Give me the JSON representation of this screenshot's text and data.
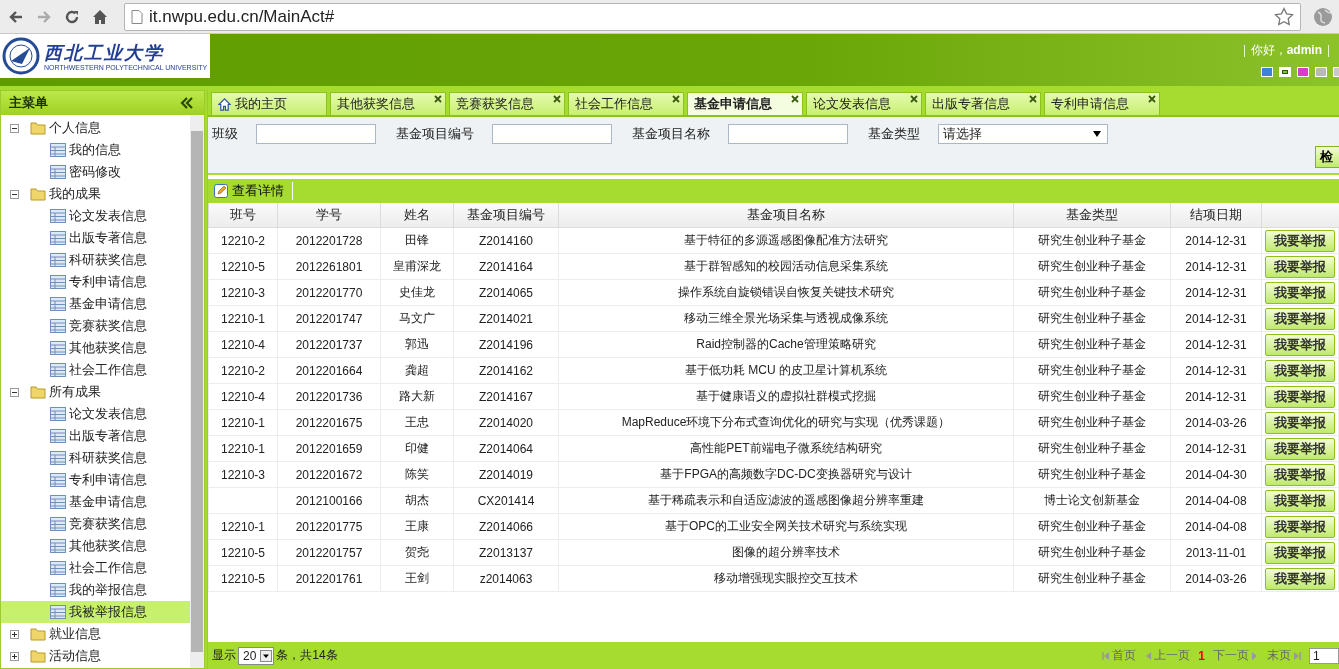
{
  "browser": {
    "url": "it.nwpu.edu.cn/MainAct#"
  },
  "header": {
    "logo_title": "西北工业大学",
    "logo_subtitle": "NORTHWESTERN POLYTECHNICAL UNIVERSITY",
    "greeting": "你好，**admin**",
    "themes": [
      {
        "color": "#3b82d8",
        "selected": false
      },
      {
        "color": "#7cc52a",
        "selected": true
      },
      {
        "color": "#d93cc8",
        "selected": false
      },
      {
        "color": "#b9b9b9",
        "selected": false
      },
      {
        "color": "#c9c9c9",
        "selected": false
      }
    ]
  },
  "sidebar": {
    "title": "主菜单",
    "tree": [
      {
        "label": "个人信息",
        "expanded": true,
        "children": [
          {
            "label": "我的信息",
            "selected": false
          },
          {
            "label": "密码修改",
            "selected": false
          }
        ]
      },
      {
        "label": "我的成果",
        "expanded": true,
        "children": [
          {
            "label": "论文发表信息",
            "selected": false
          },
          {
            "label": "出版专著信息",
            "selected": false
          },
          {
            "label": "科研获奖信息",
            "selected": false
          },
          {
            "label": "专利申请信息",
            "selected": false
          },
          {
            "label": "基金申请信息",
            "selected": false
          },
          {
            "label": "竞赛获奖信息",
            "selected": false
          },
          {
            "label": "其他获奖信息",
            "selected": false
          },
          {
            "label": "社会工作信息",
            "selected": false
          }
        ]
      },
      {
        "label": "所有成果",
        "expanded": true,
        "children": [
          {
            "label": "论文发表信息",
            "selected": false
          },
          {
            "label": "出版专著信息",
            "selected": false
          },
          {
            "label": "科研获奖信息",
            "selected": false
          },
          {
            "label": "专利申请信息",
            "selected": false
          },
          {
            "label": "基金申请信息",
            "selected": false
          },
          {
            "label": "竞赛获奖信息",
            "selected": false
          },
          {
            "label": "其他获奖信息",
            "selected": false
          },
          {
            "label": "社会工作信息",
            "selected": false
          },
          {
            "label": "我的举报信息",
            "selected": false
          },
          {
            "label": "我被举报信息",
            "selected": true
          }
        ]
      },
      {
        "label": "就业信息",
        "expanded": false
      },
      {
        "label": "活动信息",
        "expanded": false
      }
    ]
  },
  "tabs": [
    {
      "label": "我的主页",
      "kind": "home",
      "selected": false
    },
    {
      "label": "其他获奖信息",
      "kind": "closable",
      "selected": false
    },
    {
      "label": "竞赛获奖信息",
      "kind": "closable",
      "selected": false
    },
    {
      "label": "社会工作信息",
      "kind": "closable",
      "selected": false
    },
    {
      "label": "基金申请信息",
      "kind": "closable",
      "selected": true
    },
    {
      "label": "论文发表信息",
      "kind": "closable",
      "selected": false
    },
    {
      "label": "出版专著信息",
      "kind": "closable",
      "selected": false
    },
    {
      "label": "专利申请信息",
      "kind": "closable",
      "selected": false
    }
  ],
  "filters": [
    {
      "label": "班级",
      "kind": "input"
    },
    {
      "label": "基金项目编号",
      "kind": "input"
    },
    {
      "label": "基金项目名称",
      "kind": "input"
    },
    {
      "label": "基金类型",
      "kind": "select",
      "value": "请选择"
    }
  ],
  "search_button": "检",
  "toolbar": {
    "view_details": "查看详情"
  },
  "table": {
    "columns": [
      "班号",
      "学号",
      "姓名",
      "基金项目编号",
      "基金项目名称",
      "基金类型",
      "结项日期"
    ],
    "rows": [
      {
        "cells": [
          "12210-2",
          "2012201728",
          "田锋",
          "Z2014160",
          "基于特征的多源遥感图像配准方法研究",
          "研究生创业种子基金",
          "2014-12-31"
        ],
        "action": "我要举报"
      },
      {
        "cells": [
          "12210-5",
          "2012261801",
          "皇甫深龙",
          "Z2014164",
          "基于群智感知的校园活动信息采集系统",
          "研究生创业种子基金",
          "2014-12-31"
        ],
        "action": "我要举报"
      },
      {
        "cells": [
          "12210-3",
          "2012201770",
          "史佳龙",
          "Z2014065",
          "操作系统自旋锁错误自恢复关键技术研究",
          "研究生创业种子基金",
          "2014-12-31"
        ],
        "action": "我要举报"
      },
      {
        "cells": [
          "12210-1",
          "2012201747",
          "马文广",
          "Z2014021",
          "移动三维全景光场采集与透视成像系统",
          "研究生创业种子基金",
          "2014-12-31"
        ],
        "action": "我要举报"
      },
      {
        "cells": [
          "12210-4",
          "2012201737",
          "郭迅",
          "Z2014196",
          "Raid控制器的Cache管理策略研究",
          "研究生创业种子基金",
          "2014-12-31"
        ],
        "action": "我要举报"
      },
      {
        "cells": [
          "12210-2",
          "2012201664",
          "龚超",
          "Z2014162",
          "基于低功耗 MCU 的皮卫星计算机系统",
          "研究生创业种子基金",
          "2014-12-31"
        ],
        "action": "我要举报"
      },
      {
        "cells": [
          "12210-4",
          "2012201736",
          "路大新",
          "Z2014167",
          "基于健康语义的虚拟社群模式挖掘",
          "研究生创业种子基金",
          "2014-12-31"
        ],
        "action": "我要举报"
      },
      {
        "cells": [
          "12210-1",
          "2012201675",
          "王忠",
          "Z2014020",
          "MapReduce环境下分布式查询优化的研究与实现（优秀课题）",
          "研究生创业种子基金",
          "2014-03-26"
        ],
        "action": "我要举报"
      },
      {
        "cells": [
          "12210-1",
          "2012201659",
          "印健",
          "Z2014064",
          "高性能PET前端电子微系统结构研究",
          "研究生创业种子基金",
          "2014-12-31"
        ],
        "action": "我要举报"
      },
      {
        "cells": [
          "12210-3",
          "2012201672",
          "陈笑",
          "Z2014019",
          "基于FPGA的高频数字DC-DC变换器研究与设计",
          "研究生创业种子基金",
          "2014-04-30"
        ],
        "action": "我要举报"
      },
      {
        "cells": [
          "",
          "2012100166",
          "胡杰",
          "CX201414",
          "基于稀疏表示和自适应滤波的遥感图像超分辨率重建",
          "博士论文创新基金",
          "2014-04-08"
        ],
        "action": "我要举报"
      },
      {
        "cells": [
          "12210-1",
          "2012201775",
          "王康",
          "Z2014066",
          "基于OPC的工业安全网关技术研究与系统实现",
          "研究生创业种子基金",
          "2014-04-08"
        ],
        "action": "我要举报"
      },
      {
        "cells": [
          "12210-5",
          "2012201757",
          "贺尧",
          "Z2013137",
          "图像的超分辨率技术",
          "研究生创业种子基金",
          "2013-11-01"
        ],
        "action": "我要举报"
      },
      {
        "cells": [
          "12210-5",
          "2012201761",
          "王剑",
          "z2014063",
          "移动增强现实眼控交互技术",
          "研究生创业种子基金",
          "2014-03-26"
        ],
        "action": "我要举报"
      }
    ]
  },
  "pager": {
    "show_label": "显示",
    "page_size": "20",
    "count_text": "条，共14条",
    "nav": [
      {
        "label": "首页",
        "kind": "first"
      },
      {
        "label": "上一页",
        "kind": "prev"
      },
      {
        "label": "1",
        "kind": "current"
      },
      {
        "label": "下一页",
        "kind": "next"
      },
      {
        "label": "末页",
        "kind": "last"
      }
    ],
    "page_input": "1"
  }
}
